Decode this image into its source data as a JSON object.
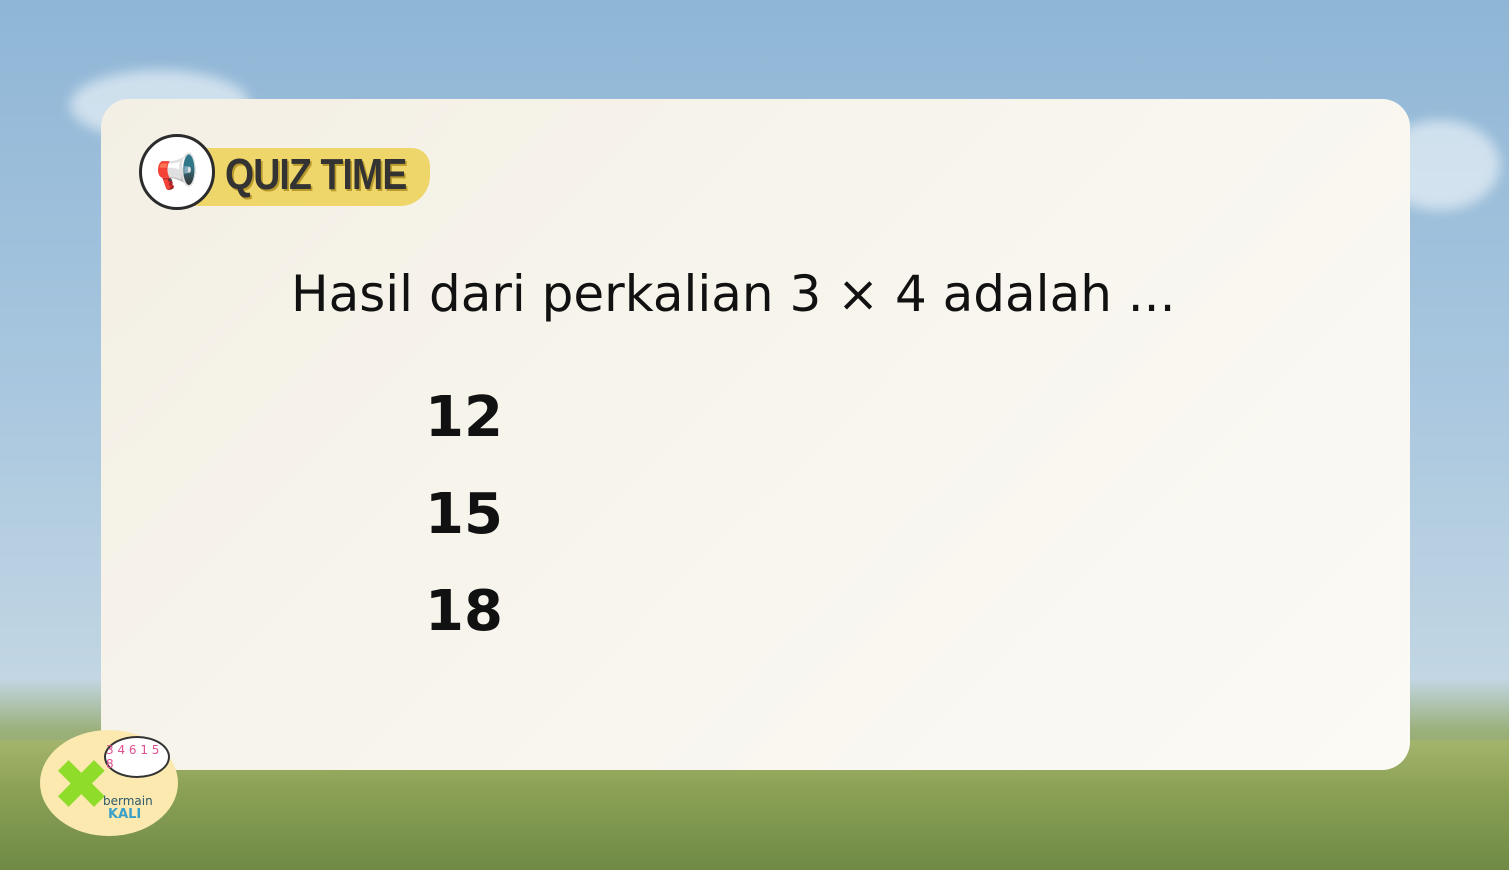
{
  "badge": {
    "label": "QUIZ TIME",
    "icon": "megaphone-icon"
  },
  "question": "Hasil dari perkalian 3 × 4 adalah ...",
  "options": [
    "12",
    "15",
    "18"
  ],
  "logo": {
    "line1": "bermain",
    "line2": "KALI",
    "bubble": "3 4 6 1 5 8"
  },
  "colors": {
    "accent": "#efd66a",
    "text": "#111111"
  }
}
